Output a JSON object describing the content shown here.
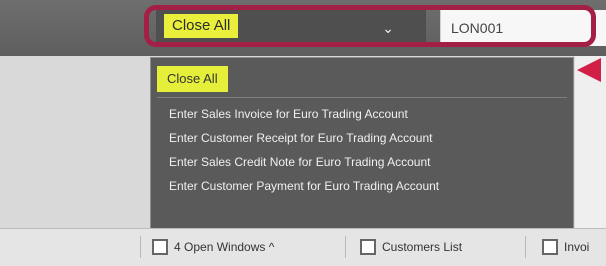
{
  "header": {
    "selected_action": "Close All",
    "account_code": "LON001"
  },
  "dropdown": {
    "items": [
      "Close All",
      "Enter Sales Invoice for Euro Trading Account",
      "Enter Customer Receipt for Euro Trading Account",
      "Enter Sales Credit Note for Euro Trading Account",
      "Enter Customer Payment for Euro Trading Account"
    ]
  },
  "taskbar": {
    "items": [
      {
        "label": "4 Open Windows ^",
        "icon": "open-windows-icon"
      },
      {
        "label": "Customers List",
        "icon": "list-window-icon"
      },
      {
        "label": "Invoi",
        "icon": "invoice-window-icon"
      }
    ]
  },
  "colors": {
    "highlight_yellow": "#e5ee38",
    "callout_red": "#a41f46",
    "dropdown_bg": "#5a5a5a"
  }
}
